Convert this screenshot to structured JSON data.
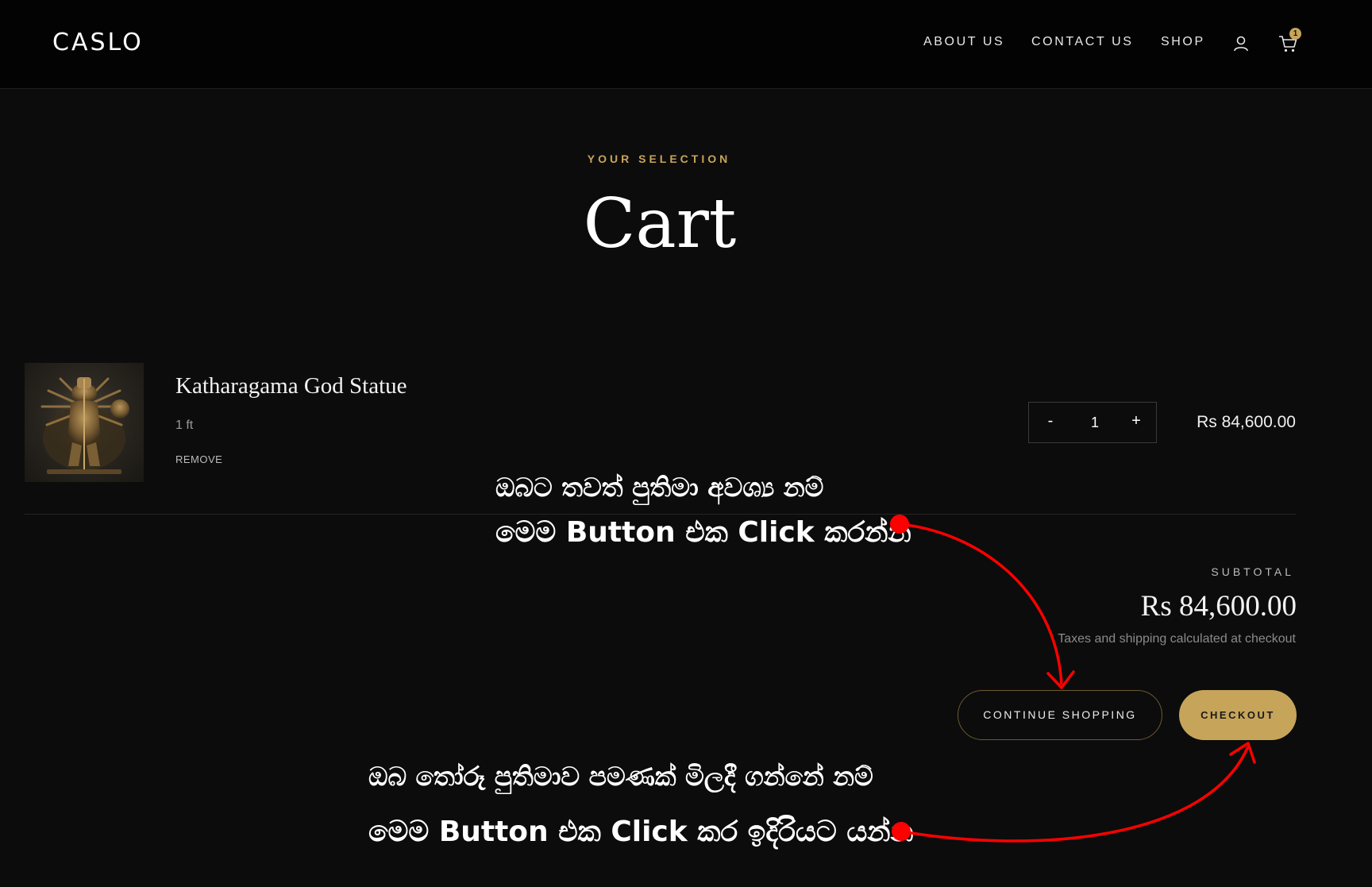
{
  "header": {
    "logo": "CASLO",
    "nav": [
      {
        "label": "ABOUT US"
      },
      {
        "label": "CONTACT US"
      },
      {
        "label": "SHOP"
      }
    ],
    "account_icon": "user-icon",
    "cart_icon": "cart-icon",
    "cart_count": "1"
  },
  "page": {
    "eyebrow": "YOUR SELECTION",
    "title": "Cart"
  },
  "cart": {
    "items": [
      {
        "name": "Katharagama God Statue",
        "variant": "1 ft",
        "remove_label": "REMOVE",
        "qty_minus": "-",
        "qty_value": "1",
        "qty_plus": "+",
        "price": "Rs 84,600.00"
      }
    ],
    "subtotal_label": "SUBTOTAL",
    "subtotal_value": "Rs 84,600.00",
    "tax_note": "Taxes and shipping calculated at checkout",
    "continue_label": "CONTINUE SHOPPING",
    "checkout_label": "CHECKOUT"
  },
  "annotations": {
    "continue_line1": "ඔබට තවත් පුතිමා අවශ්‍ය නම්",
    "continue_line2": "මෙම Button එක Click කරන්න",
    "checkout_line1": "ඔබ තෝරූ පුතිමාව පමණක් මිලදී ගන්නේ නම්",
    "checkout_line2": "මෙම Button එක Click කර ඉදිරියට යන්න",
    "color": "#ff0000"
  },
  "colors": {
    "background": "#0c0c0c",
    "header": "#030303",
    "accent": "#c6a45a"
  }
}
